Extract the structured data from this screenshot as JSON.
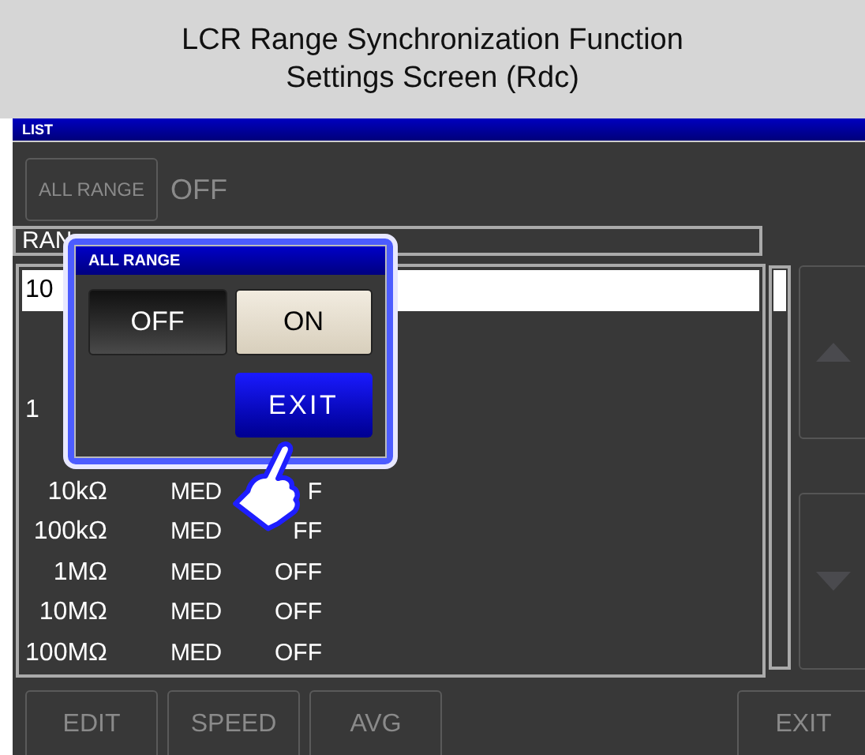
{
  "caption": {
    "lines": [
      "LCR Range Synchronization Function",
      "Settings Screen (Rdc)"
    ]
  },
  "screen_title": "LIST",
  "all_range": {
    "label": "ALL RANGE",
    "value": "OFF",
    "disabled": true
  },
  "table": {
    "columns": [
      "RAN"
    ],
    "rows": [
      {
        "range": "10",
        "selected": true,
        "covered": true
      },
      {
        "range": "1",
        "selected": false,
        "covered": true
      },
      {
        "range": "10kΩ",
        "speed": "MED",
        "average": "F",
        "selected": false,
        "covered": false
      },
      {
        "range": "100kΩ",
        "speed": "MED",
        "average": "FF",
        "selected": false,
        "covered": false
      },
      {
        "range": "1MΩ",
        "speed": "MED",
        "average": "OFF",
        "selected": false,
        "covered": false
      },
      {
        "range": "10MΩ",
        "speed": "MED",
        "average": "OFF",
        "selected": false,
        "covered": false
      },
      {
        "range": "100MΩ",
        "speed": "MED",
        "average": "OFF",
        "selected": false,
        "covered": false
      }
    ]
  },
  "dialog": {
    "title": "ALL RANGE",
    "options": [
      {
        "label": "OFF",
        "selected": false
      },
      {
        "label": "ON",
        "selected": true
      }
    ],
    "exit": "EXIT"
  },
  "bottom_buttons": [
    {
      "label": "EDIT",
      "disabled": true
    },
    {
      "label": "SPEED",
      "disabled": true
    },
    {
      "label": "AVG",
      "disabled": true
    }
  ],
  "exit_button": {
    "label": "EXIT",
    "disabled": true
  }
}
